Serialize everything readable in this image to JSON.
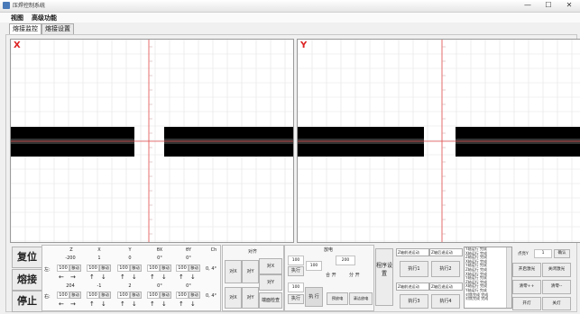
{
  "window": {
    "title": "压焊控制系统",
    "min": "—",
    "max": "☐",
    "close": "✕"
  },
  "menu": [
    "视图",
    "高级功能"
  ],
  "tabs": [
    {
      "label": "熔接监控",
      "active": true
    },
    {
      "label": "熔接设置",
      "active": false
    }
  ],
  "views": [
    {
      "axis": "X",
      "fiber_color": "#000000",
      "fiber_band_color": "#333333",
      "centerline_color": "#e24a4a"
    },
    {
      "axis": "Y",
      "fiber_color": "#000000",
      "fiber_band_color": "#333333",
      "centerline_color": "#e24a4a"
    }
  ],
  "control_buttons": {
    "reset": "复位",
    "splice": "熔接",
    "stop": "停止"
  },
  "motor_table": {
    "headers": [
      "Z",
      "X",
      "Y",
      "θX",
      "θY",
      "Ch"
    ],
    "row1_values": [
      "-200",
      "1",
      "0",
      "0°",
      "0°"
    ],
    "row2_label": "左:",
    "row2_inputs": [
      "100",
      "100",
      "100",
      "100",
      "100"
    ],
    "move_label": "移动",
    "row2_extra": "0, 4°",
    "row3_label": "右:",
    "row3_values": [
      "204",
      "-1",
      "2",
      "0°",
      "0°"
    ],
    "row3_extra": "0, 4°",
    "arrows_left": "←",
    "arrows_right": "→",
    "arrows_up": "↑",
    "arrows_down": "↓"
  },
  "align_panel": {
    "title": "对齐",
    "buttons": [
      "对X",
      "对Y",
      "对Z",
      "端面检查"
    ],
    "left_buttons": [
      "对X",
      "对Y"
    ]
  },
  "arc_panel": {
    "title": "放电",
    "inputs": [
      "100",
      "100",
      "100",
      "100"
    ],
    "exec_labels": [
      "执行",
      "执行"
    ],
    "open_label": "合 开",
    "split_label": "分 开",
    "exec_big": "执 行",
    "small1": "预放电",
    "small2": "清洁放电",
    "value_box": "200"
  },
  "program": {
    "label": "程序设置",
    "selects": [
      "Z轴前进运动",
      "Z轴后退运动",
      "Z轴前进运动",
      "Z轴后退运动"
    ],
    "exec_buttons": [
      "执行1",
      "执行2",
      "执行3",
      "执行4"
    ]
  },
  "log_list": [
    "Y轴运行 完成",
    "X轴运行 完成",
    "Z轴运行 完成",
    "X轴运行 完成",
    "Y轴运行 完成",
    "Z轴运行 完成",
    "X轴运行 完成",
    "Y轴运行 完成",
    "Z轴运行 完成",
    "X轴运行 完成",
    "Y轴运行 完成",
    "对焦完成 完成",
    "对焦完成 完成"
  ],
  "right_panel": {
    "port_label": "点亮Y",
    "port_value": "1",
    "port_btn": "确认",
    "buttons": [
      "开启激光",
      "关闭激光",
      "清零++",
      "清零--",
      "开灯",
      "关灯"
    ]
  }
}
